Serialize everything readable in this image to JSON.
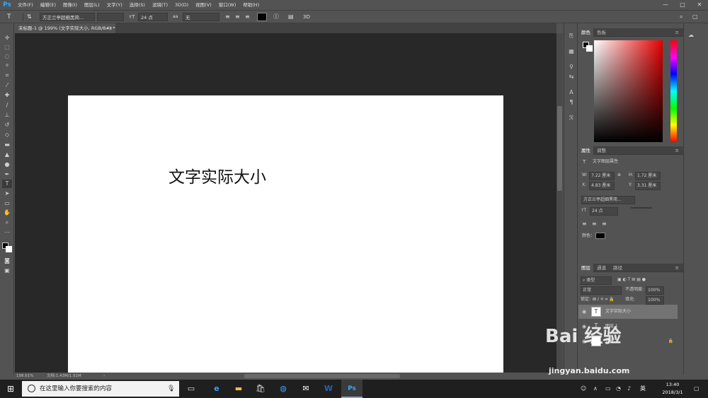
{
  "app": {
    "logo": "Ps"
  },
  "menu": [
    "文件(F)",
    "编辑(E)",
    "图像(I)",
    "图层(L)",
    "文字(Y)",
    "选择(S)",
    "滤镜(T)",
    "3D(D)",
    "视图(V)",
    "窗口(W)",
    "帮助(H)"
  ],
  "window_controls": {
    "minimize": "—",
    "maximize": "□",
    "close": "✕"
  },
  "options": {
    "tool_glyph": "T",
    "font_family": "方正兰亭超细黑简...",
    "font_size": "24 点",
    "antialias": "无"
  },
  "document": {
    "tab_title": "未标题-1 @ 199% (文字实际大小, RGB/8#) *",
    "tab_close": "×",
    "text": "文字实际大小"
  },
  "status": {
    "zoom": "198.61%",
    "doc_size": "文档:1.43M/1.91M"
  },
  "panels": {
    "color": {
      "tabs": [
        "颜色",
        "色板"
      ]
    },
    "properties": {
      "tabs": [
        "属性",
        "调整"
      ],
      "layer_type": "文字图层属性",
      "w_label": "W:",
      "w_value": "7.22 厘米",
      "h_label": "H:",
      "h_value": "1.72 厘米",
      "x_label": "X:",
      "x_value": "4.83 厘米",
      "y_label": "Y:",
      "y_value": "3.31 厘米",
      "font_family": "方正兰亭超细黑简...",
      "font_size": "24 点",
      "color_label": "颜色："
    },
    "layers": {
      "tabs": [
        "图层",
        "通道",
        "路径"
      ],
      "filter": "类型",
      "blend_mode": "正常",
      "opacity_label": "不透明度:",
      "opacity_value": "100%",
      "lock_label": "锁定:",
      "fill_label": "填充:",
      "fill_value": "100%",
      "items": [
        {
          "name": "文字实际大小",
          "thumb": "T"
        },
        {
          "name": "图层 1",
          "thumb": "T"
        },
        {
          "name": "背景",
          "thumb": ""
        }
      ]
    }
  },
  "taskbar": {
    "search_placeholder": "在这里输入你要搜索的内容",
    "ime": "英",
    "time": "13:40",
    "date": "2018/3/1"
  },
  "watermark": {
    "brand": "Bai 经验",
    "url": "jingyan.baidu.com"
  },
  "colors": {
    "ps_blue": "#31a8ff",
    "panel_bg": "#535353",
    "canvas_bg": "#282828",
    "taskbar_bg": "#1f1f1f"
  }
}
